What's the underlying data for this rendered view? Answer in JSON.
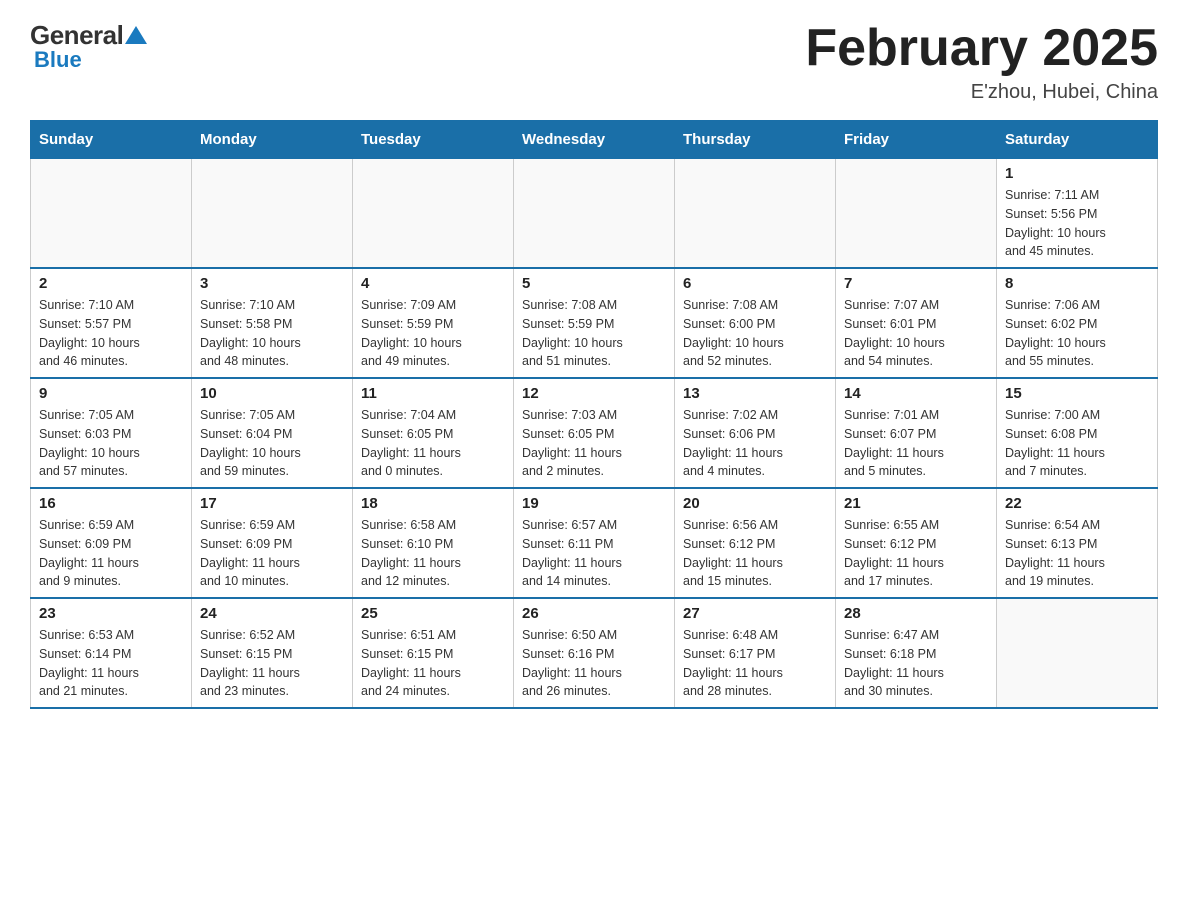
{
  "logo": {
    "general": "General",
    "triangle_color": "#1a7abf",
    "blue": "Blue"
  },
  "title": "February 2025",
  "subtitle": "E'zhou, Hubei, China",
  "days_of_week": [
    "Sunday",
    "Monday",
    "Tuesday",
    "Wednesday",
    "Thursday",
    "Friday",
    "Saturday"
  ],
  "weeks": [
    {
      "days": [
        {
          "number": "",
          "info": "",
          "empty": true
        },
        {
          "number": "",
          "info": "",
          "empty": true
        },
        {
          "number": "",
          "info": "",
          "empty": true
        },
        {
          "number": "",
          "info": "",
          "empty": true
        },
        {
          "number": "",
          "info": "",
          "empty": true
        },
        {
          "number": "",
          "info": "",
          "empty": true
        },
        {
          "number": "1",
          "info": "Sunrise: 7:11 AM\nSunset: 5:56 PM\nDaylight: 10 hours\nand 45 minutes."
        }
      ]
    },
    {
      "days": [
        {
          "number": "2",
          "info": "Sunrise: 7:10 AM\nSunset: 5:57 PM\nDaylight: 10 hours\nand 46 minutes."
        },
        {
          "number": "3",
          "info": "Sunrise: 7:10 AM\nSunset: 5:58 PM\nDaylight: 10 hours\nand 48 minutes."
        },
        {
          "number": "4",
          "info": "Sunrise: 7:09 AM\nSunset: 5:59 PM\nDaylight: 10 hours\nand 49 minutes."
        },
        {
          "number": "5",
          "info": "Sunrise: 7:08 AM\nSunset: 5:59 PM\nDaylight: 10 hours\nand 51 minutes."
        },
        {
          "number": "6",
          "info": "Sunrise: 7:08 AM\nSunset: 6:00 PM\nDaylight: 10 hours\nand 52 minutes."
        },
        {
          "number": "7",
          "info": "Sunrise: 7:07 AM\nSunset: 6:01 PM\nDaylight: 10 hours\nand 54 minutes."
        },
        {
          "number": "8",
          "info": "Sunrise: 7:06 AM\nSunset: 6:02 PM\nDaylight: 10 hours\nand 55 minutes."
        }
      ]
    },
    {
      "days": [
        {
          "number": "9",
          "info": "Sunrise: 7:05 AM\nSunset: 6:03 PM\nDaylight: 10 hours\nand 57 minutes."
        },
        {
          "number": "10",
          "info": "Sunrise: 7:05 AM\nSunset: 6:04 PM\nDaylight: 10 hours\nand 59 minutes."
        },
        {
          "number": "11",
          "info": "Sunrise: 7:04 AM\nSunset: 6:05 PM\nDaylight: 11 hours\nand 0 minutes."
        },
        {
          "number": "12",
          "info": "Sunrise: 7:03 AM\nSunset: 6:05 PM\nDaylight: 11 hours\nand 2 minutes."
        },
        {
          "number": "13",
          "info": "Sunrise: 7:02 AM\nSunset: 6:06 PM\nDaylight: 11 hours\nand 4 minutes."
        },
        {
          "number": "14",
          "info": "Sunrise: 7:01 AM\nSunset: 6:07 PM\nDaylight: 11 hours\nand 5 minutes."
        },
        {
          "number": "15",
          "info": "Sunrise: 7:00 AM\nSunset: 6:08 PM\nDaylight: 11 hours\nand 7 minutes."
        }
      ]
    },
    {
      "days": [
        {
          "number": "16",
          "info": "Sunrise: 6:59 AM\nSunset: 6:09 PM\nDaylight: 11 hours\nand 9 minutes."
        },
        {
          "number": "17",
          "info": "Sunrise: 6:59 AM\nSunset: 6:09 PM\nDaylight: 11 hours\nand 10 minutes."
        },
        {
          "number": "18",
          "info": "Sunrise: 6:58 AM\nSunset: 6:10 PM\nDaylight: 11 hours\nand 12 minutes."
        },
        {
          "number": "19",
          "info": "Sunrise: 6:57 AM\nSunset: 6:11 PM\nDaylight: 11 hours\nand 14 minutes."
        },
        {
          "number": "20",
          "info": "Sunrise: 6:56 AM\nSunset: 6:12 PM\nDaylight: 11 hours\nand 15 minutes."
        },
        {
          "number": "21",
          "info": "Sunrise: 6:55 AM\nSunset: 6:12 PM\nDaylight: 11 hours\nand 17 minutes."
        },
        {
          "number": "22",
          "info": "Sunrise: 6:54 AM\nSunset: 6:13 PM\nDaylight: 11 hours\nand 19 minutes."
        }
      ]
    },
    {
      "days": [
        {
          "number": "23",
          "info": "Sunrise: 6:53 AM\nSunset: 6:14 PM\nDaylight: 11 hours\nand 21 minutes."
        },
        {
          "number": "24",
          "info": "Sunrise: 6:52 AM\nSunset: 6:15 PM\nDaylight: 11 hours\nand 23 minutes."
        },
        {
          "number": "25",
          "info": "Sunrise: 6:51 AM\nSunset: 6:15 PM\nDaylight: 11 hours\nand 24 minutes."
        },
        {
          "number": "26",
          "info": "Sunrise: 6:50 AM\nSunset: 6:16 PM\nDaylight: 11 hours\nand 26 minutes."
        },
        {
          "number": "27",
          "info": "Sunrise: 6:48 AM\nSunset: 6:17 PM\nDaylight: 11 hours\nand 28 minutes."
        },
        {
          "number": "28",
          "info": "Sunrise: 6:47 AM\nSunset: 6:18 PM\nDaylight: 11 hours\nand 30 minutes."
        },
        {
          "number": "",
          "info": "",
          "empty": true
        }
      ]
    }
  ]
}
